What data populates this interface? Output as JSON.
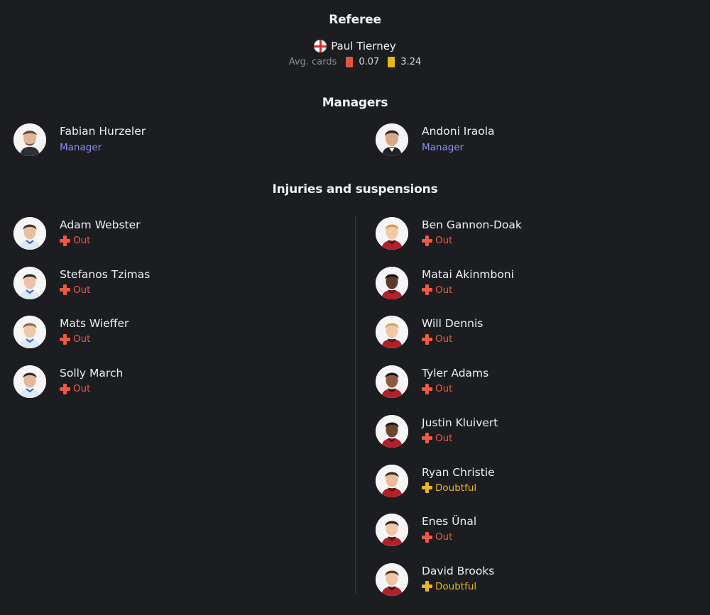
{
  "referee": {
    "section_title": "Referee",
    "name": "Paul Tierney",
    "flag_icon": "england-flag-icon",
    "avg_cards_label": "Avg. cards",
    "red_cards": "0.07",
    "yellow_cards": "3.24"
  },
  "managers": {
    "section_title": "Managers",
    "home": {
      "name": "Fabian Hurzeler",
      "role": "Manager"
    },
    "away": {
      "name": "Andoni Iraola",
      "role": "Manager"
    }
  },
  "injuries": {
    "section_title": "Injuries and suspensions",
    "home": [
      {
        "name": "Adam Webster",
        "status": "Out"
      },
      {
        "name": "Stefanos Tzimas",
        "status": "Out"
      },
      {
        "name": "Mats Wieffer",
        "status": "Out"
      },
      {
        "name": "Solly March",
        "status": "Out"
      }
    ],
    "away": [
      {
        "name": "Ben Gannon-Doak",
        "status": "Out"
      },
      {
        "name": "Matai Akinmboni",
        "status": "Out"
      },
      {
        "name": "Will Dennis",
        "status": "Out"
      },
      {
        "name": "Tyler Adams",
        "status": "Out"
      },
      {
        "name": "Justin Kluivert",
        "status": "Out"
      },
      {
        "name": "Ryan Christie",
        "status": "Doubtful"
      },
      {
        "name": "Enes Ünal",
        "status": "Out"
      },
      {
        "name": "David Brooks",
        "status": "Doubtful"
      }
    ]
  },
  "colors": {
    "background": "#1b1d20",
    "manager_role": "#8b93f4",
    "status_out": "#ec5a44",
    "status_doubtful": "#e8b62c",
    "red_card": "#e0553f",
    "yellow_card": "#e8b90f"
  }
}
